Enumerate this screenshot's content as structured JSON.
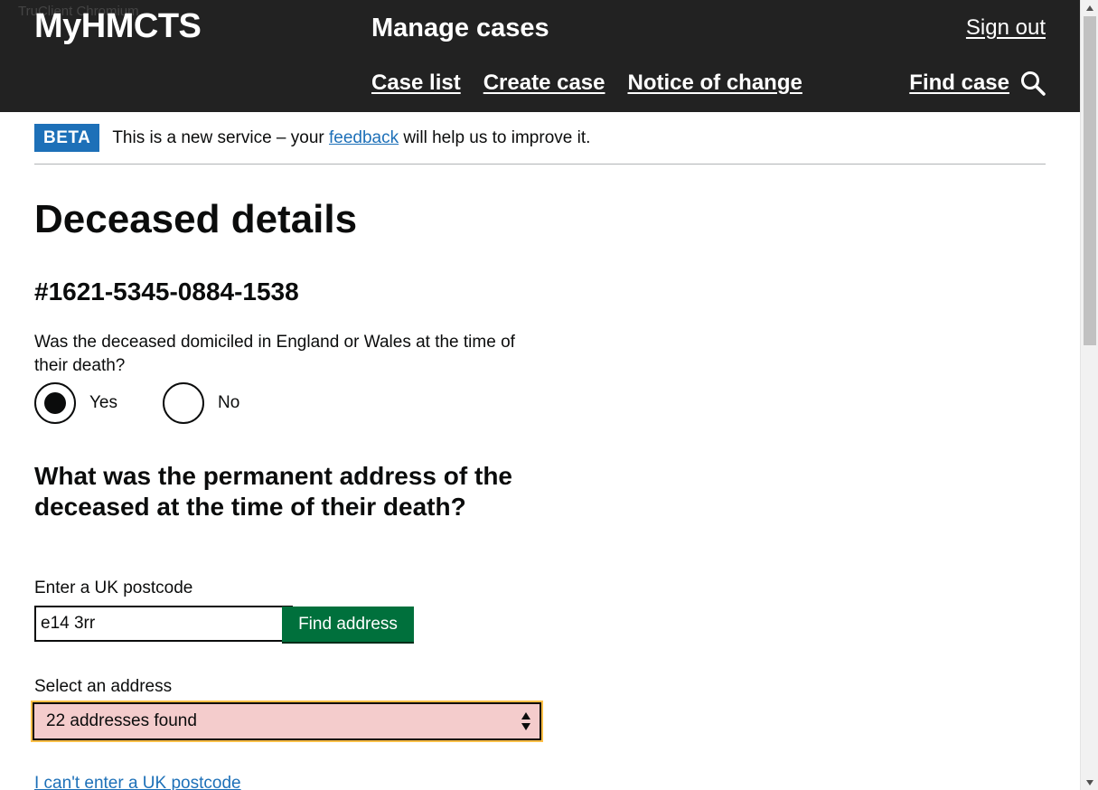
{
  "window": {
    "title": "TruClient Chromium"
  },
  "header": {
    "brand": "MyHMCTS",
    "service_name": "Manage cases",
    "sign_out": "Sign out",
    "nav": [
      "Case list",
      "Create case",
      "Notice of change"
    ],
    "find_case": "Find case",
    "background_color": "#222222"
  },
  "phase_banner": {
    "tag": "BETA",
    "text_before": "This is a new service – your ",
    "link": "feedback",
    "text_after": " will help us to improve it."
  },
  "main": {
    "title": "Deceased details",
    "case_reference": "#1621-5345-0884-1538",
    "domicile_question": "Was the deceased domiciled in England or Wales at the time of their death?",
    "radio_options": [
      {
        "label": "Yes",
        "selected": true
      },
      {
        "label": "No",
        "selected": false
      }
    ],
    "address_heading": "What was the permanent address of the deceased at the time of their death?",
    "postcode_label": "Enter a UK postcode",
    "postcode_value": "e14 3rr",
    "find_address_button": "Find address",
    "select_label": "Select an address",
    "select_value": "22 addresses found",
    "manual_link": "I can't enter a UK postcode"
  },
  "colors": {
    "link": "#1d70b8",
    "button_green": "#00703c",
    "beta_blue": "#1d70b8",
    "select_error_bg": "#f4cccc",
    "focus_yellow": "#ffbf47"
  }
}
